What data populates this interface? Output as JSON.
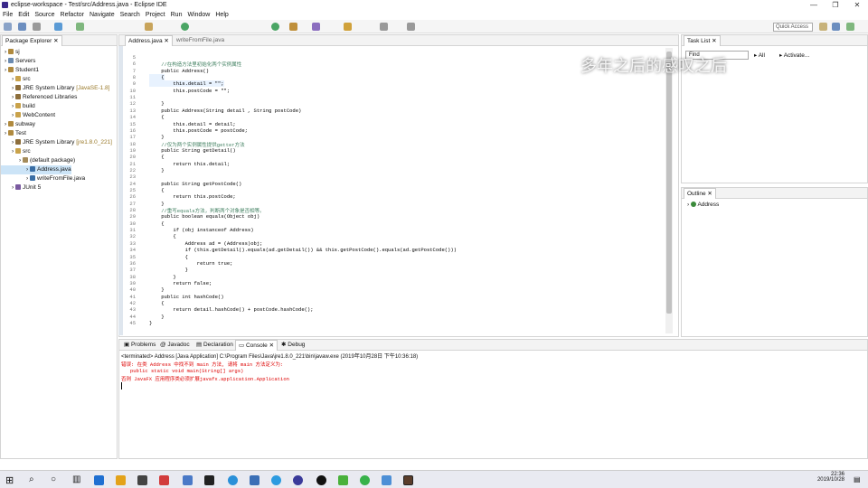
{
  "window": {
    "title": "eclipse-workspace - Test/src/Address.java - Eclipse IDE"
  },
  "menu": [
    "File",
    "Edit",
    "Source",
    "Refactor",
    "Navigate",
    "Search",
    "Project",
    "Run",
    "Window",
    "Help"
  ],
  "quick_access": "Quick Access",
  "package_explorer": {
    "tab": "Package Explorer",
    "items": [
      {
        "label": "sj",
        "indent": 0
      },
      {
        "label": "Servers",
        "indent": 0
      },
      {
        "label": "Student1",
        "indent": 0
      },
      {
        "label": "src",
        "indent": 1
      },
      {
        "label": "JRE System Library",
        "extra": "[JavaSE-1.8]",
        "indent": 1
      },
      {
        "label": "Referenced Libraries",
        "indent": 1
      },
      {
        "label": "build",
        "indent": 1
      },
      {
        "label": "WebContent",
        "indent": 1
      },
      {
        "label": "subway",
        "indent": 0
      },
      {
        "label": "Test",
        "indent": 0
      },
      {
        "label": "JRE System Library",
        "extra": "[jre1.8.0_221]",
        "indent": 1
      },
      {
        "label": "src",
        "indent": 1
      },
      {
        "label": "(default package)",
        "indent": 2
      },
      {
        "label": "Address.java",
        "indent": 3
      },
      {
        "label": "writeFromFile.java",
        "indent": 3
      },
      {
        "label": "JUnit 5",
        "indent": 1
      }
    ]
  },
  "editor": {
    "tabs": [
      "Address.java",
      "writeFromFile.java"
    ],
    "lines": [
      {
        "n": "5",
        "t": ""
      },
      {
        "n": "6",
        "t": "    //在构造方法里初始化两个实例属性",
        "c": "cmt"
      },
      {
        "n": "7",
        "t": "    public Address()"
      },
      {
        "n": "8",
        "t": "    {"
      },
      {
        "n": "9",
        "t": "        this.detail = \"\";"
      },
      {
        "n": "10",
        "t": "        this.postCode = \"\";"
      },
      {
        "n": "11",
        "t": ""
      },
      {
        "n": "12",
        "t": "    }"
      },
      {
        "n": "13",
        "t": "    public Address(String detail , String postCode)"
      },
      {
        "n": "14",
        "t": "    {"
      },
      {
        "n": "15",
        "t": "        this.detail = detail;"
      },
      {
        "n": "16",
        "t": "        this.postCode = postCode;"
      },
      {
        "n": "17",
        "t": "    }"
      },
      {
        "n": "18",
        "t": "    //仅为两个实例属性提供getter方法",
        "c": "cmt"
      },
      {
        "n": "19",
        "t": "    public String getDetail()"
      },
      {
        "n": "20",
        "t": "    {"
      },
      {
        "n": "21",
        "t": "        return this.detail;"
      },
      {
        "n": "22",
        "t": "    }"
      },
      {
        "n": "23",
        "t": ""
      },
      {
        "n": "24",
        "t": "    public String getPostCode()"
      },
      {
        "n": "25",
        "t": "    {"
      },
      {
        "n": "26",
        "t": "        return this.postCode;"
      },
      {
        "n": "27",
        "t": "    }"
      },
      {
        "n": "28",
        "t": "    //重写equals方法，判断两个对象是否相等。",
        "c": "cmt"
      },
      {
        "n": "29",
        "t": "    public boolean equals(Object obj)"
      },
      {
        "n": "30",
        "t": "    {"
      },
      {
        "n": "31",
        "t": "        if (obj instanceof Address)"
      },
      {
        "n": "32",
        "t": "        {"
      },
      {
        "n": "33",
        "t": "            Address ad = (Address)obj;"
      },
      {
        "n": "34",
        "t": "            if (this.getDetail().equals(ad.getDetail()) && this.getPostCode().equals(ad.getPostCode()))"
      },
      {
        "n": "35",
        "t": "            {"
      },
      {
        "n": "36",
        "t": "                return true;"
      },
      {
        "n": "37",
        "t": "            }"
      },
      {
        "n": "38",
        "t": "        }"
      },
      {
        "n": "39",
        "t": "        return false;"
      },
      {
        "n": "40",
        "t": "    }"
      },
      {
        "n": "41",
        "t": "    public int hashCode()"
      },
      {
        "n": "42",
        "t": "    {"
      },
      {
        "n": "43",
        "t": "        return detail.hashCode() + postCode.hashCode();"
      },
      {
        "n": "44",
        "t": "    }"
      },
      {
        "n": "45",
        "t": "}"
      }
    ]
  },
  "task_list": {
    "tab": "Task List",
    "find": "Find",
    "all": "All",
    "activate": "Activate..."
  },
  "outline": {
    "tab": "Outline",
    "item": "Address"
  },
  "watermark": "多年之后的感叹之后",
  "console": {
    "tabs": [
      "Problems",
      "Javadoc",
      "Declaration",
      "Console",
      "Debug"
    ],
    "header": "<terminated> Address [Java Application] C:\\Program Files\\Java\\jre1.8.0_221\\bin\\javaw.exe (2019年10月28日 下午10:36:18)",
    "lines": [
      "错误: 在类 Address 中找不到 main 方法, 请将 main 方法定义为:",
      "   public static void main(String[] args)",
      "否则 JavaFX 应用程序类必须扩展javafx.application.Application"
    ]
  },
  "clock": {
    "time": "22:36",
    "date": "2019/10/28"
  }
}
